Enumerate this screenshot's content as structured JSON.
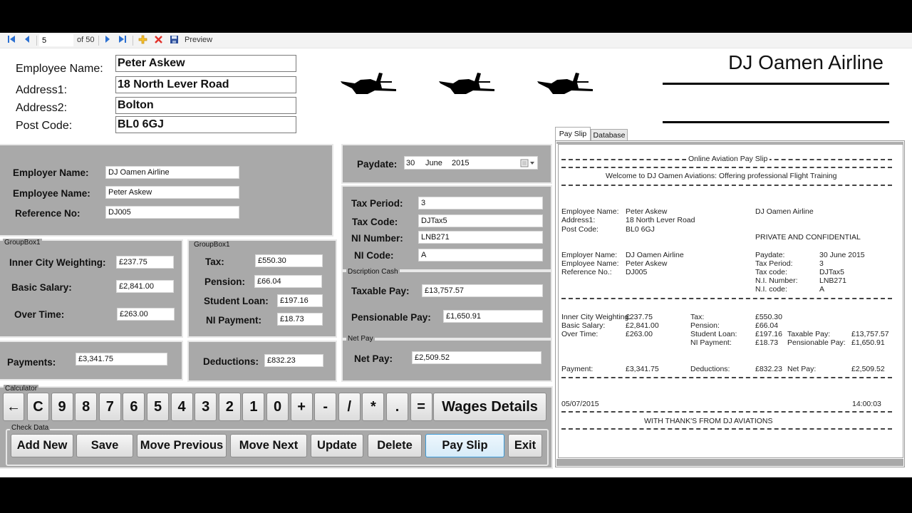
{
  "toolbar": {
    "first_icon": "first-record-icon",
    "prev_icon": "previous-record-icon",
    "position": "5",
    "of_count": "of 50",
    "next_icon": "next-record-icon",
    "last_icon": "last-record-icon",
    "add_icon": "add-record-icon",
    "delete_icon": "delete-record-icon",
    "save_icon": "save-icon",
    "preview_label": "Preview"
  },
  "header": {
    "company_title": "DJ Oamen Airline",
    "fields": [
      {
        "label": "Employee Name:",
        "value": "Peter Askew"
      },
      {
        "label": "Address1:",
        "value": "18 North Lever Road"
      },
      {
        "label": "Address2:",
        "value": "Bolton"
      },
      {
        "label": "Post Code:",
        "value": "BL0 6GJ"
      }
    ]
  },
  "employer_panel": {
    "employer_name_label": "Employer Name:",
    "employer_name": "DJ Oamen Airline",
    "employee_name_label": "Employee Name:",
    "employee_name": "Peter Askew",
    "reference_label": "Reference No:",
    "reference": "DJ005"
  },
  "earnings": {
    "group_title": "GroupBox1",
    "inner_city_label": "Inner City Weighting:",
    "inner_city": "£237.75",
    "basic_salary_label": "Basic Salary:",
    "basic_salary": "£2,841.00",
    "overtime_label": "Over Time:",
    "overtime": "£263.00",
    "payments_label": "Payments:",
    "payments": "£3,341.75"
  },
  "deductions": {
    "group_title": "GroupBox1",
    "tax_label": "Tax:",
    "tax": "£550.30",
    "pension_label": "Pension:",
    "pension": "£66.04",
    "student_loan_label": "Student Loan:",
    "student_loan": "£197.16",
    "ni_payment_label": "NI Payment:",
    "ni_payment": "£18.73",
    "deductions_label": "Deductions:",
    "deductions": "£832.23"
  },
  "paydate": {
    "label": "Paydate:",
    "day": "30",
    "month": "June",
    "year": "2015"
  },
  "tax_info": {
    "tax_period_label": "Tax Period:",
    "tax_period": "3",
    "tax_code_label": "Tax Code:",
    "tax_code": "DJTax5",
    "ni_number_label": "NI Number:",
    "ni_number": "LNB271",
    "ni_code_label": "NI Code:",
    "ni_code": "A"
  },
  "cash": {
    "group_title": "Dscription Cash",
    "taxable_label": "Taxable Pay:",
    "taxable": "£13,757.57",
    "pensionable_label": "Pensionable Pay:",
    "pensionable": "£1,650.91"
  },
  "net_pay": {
    "group_title": "Net Pay",
    "label": "Net Pay:",
    "value": "£2,509.52"
  },
  "calculator": {
    "group_title": "Calculator",
    "keys": [
      "←",
      "C",
      "9",
      "8",
      "7",
      "6",
      "5",
      "4",
      "3",
      "2",
      "1",
      "0",
      "+",
      "-",
      "/",
      "*",
      ".",
      "="
    ],
    "wages_label": "Wages Details"
  },
  "check_data": {
    "group_title": "Check Data",
    "buttons": [
      "Add New",
      "Save",
      "Move Previous",
      "Move Next",
      "Update",
      "Delete",
      "Pay Slip",
      "Exit"
    ]
  },
  "tabs": [
    {
      "label": "Pay Slip",
      "active": true
    },
    {
      "label": "Database",
      "active": false
    }
  ],
  "payslip": {
    "title": "Online Aviation Pay Slip",
    "welcome": "Welcome to DJ Oamen Aviations: Offering professional Flight Training",
    "employee_name_label": "Employee Name:",
    "employee_name": "Peter Askew",
    "address1_label": "Address1:",
    "address1": "18 North Lever Road",
    "postcode_label": "Post Code:",
    "postcode": "BL0 6GJ",
    "company": "DJ Oamen Airline",
    "confidential": "PRIVATE AND CONFIDENTIAL",
    "employer_label": "Employer Name:",
    "employer": "DJ Oamen Airline",
    "employee2_label": "Employee Name:",
    "employee2": "Peter Askew",
    "reference_label": "Reference No.:",
    "reference": "DJ005",
    "paydate_label": "Paydate:",
    "paydate": "30 June 2015",
    "tax_period_label": "Tax Period:",
    "tax_period": "3",
    "tax_code_label": "Tax code:",
    "tax_code": "DJTax5",
    "ni_number_label": "N.I. Number:",
    "ni_number": "LNB271",
    "ni_code_label": "N.I. code:",
    "ni_code": "A",
    "inner_city_label": "Inner City Weighting:",
    "inner_city": "£237.75",
    "basic_label": "Basic Salary:",
    "basic": "£2,841.00",
    "overtime_label": "Over Time:",
    "overtime": "£263.00",
    "tax_label": "Tax:",
    "tax": "£550.30",
    "pension_label": "Pension:",
    "pension": "£66.04",
    "student_label": "Student Loan:",
    "student": "£197.16",
    "ni_payment_label": "NI Payment:",
    "ni_payment": "£18.73",
    "taxable_label": "Taxable Pay:",
    "taxable": "£13,757.57",
    "pensionable_label": "Pensionable Pay:",
    "pensionable": "£1,650.91",
    "payment_label": "Payment:",
    "payment": "£3,341.75",
    "deductions_label": "Deductions:",
    "deductions": "£832.23",
    "netpay_label": "Net Pay:",
    "netpay": "£2,509.52",
    "date": "05/07/2015",
    "time": "14:00:03",
    "thanks": "WITH THANK'S FROM DJ AVIATIONS"
  }
}
